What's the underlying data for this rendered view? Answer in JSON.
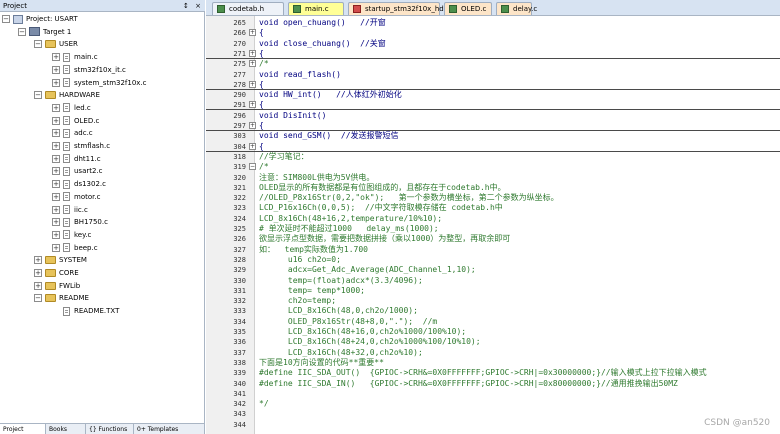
{
  "project": {
    "title": "Project",
    "header_buttons": "↕ ×",
    "tree": [
      {
        "label": "Project: USART",
        "level": 0,
        "icon": "project-root-icon",
        "expander": "−"
      },
      {
        "label": "Target 1",
        "level": 1,
        "icon": "target-icon",
        "expander": "−"
      },
      {
        "label": "USER",
        "level": 2,
        "icon": "folder-icon",
        "expander": "−"
      },
      {
        "label": "main.c",
        "level": 3,
        "icon": "c-file-icon",
        "expander": "+"
      },
      {
        "label": "stm32f10x_it.c",
        "level": 3,
        "icon": "c-file-icon",
        "expander": "+"
      },
      {
        "label": "system_stm32f10x.c",
        "level": 3,
        "icon": "c-file-icon",
        "expander": "+"
      },
      {
        "label": "HARDWARE",
        "level": 2,
        "icon": "folder-icon",
        "expander": "−"
      },
      {
        "label": "led.c",
        "level": 3,
        "icon": "c-file-icon",
        "expander": "+"
      },
      {
        "label": "OLED.c",
        "level": 3,
        "icon": "c-file-icon",
        "expander": "+"
      },
      {
        "label": "adc.c",
        "level": 3,
        "icon": "c-file-icon",
        "expander": "+"
      },
      {
        "label": "stmflash.c",
        "level": 3,
        "icon": "c-file-icon",
        "expander": "+"
      },
      {
        "label": "dht11.c",
        "level": 3,
        "icon": "c-file-icon",
        "expander": "+"
      },
      {
        "label": "usart2.c",
        "level": 3,
        "icon": "c-file-icon",
        "expander": "+"
      },
      {
        "label": "ds1302.c",
        "level": 3,
        "icon": "c-file-icon",
        "expander": "+"
      },
      {
        "label": "motor.c",
        "level": 3,
        "icon": "c-file-icon",
        "expander": "+"
      },
      {
        "label": "iic.c",
        "level": 3,
        "icon": "c-file-icon",
        "expander": "+"
      },
      {
        "label": "BH1750.c",
        "level": 3,
        "icon": "c-file-icon",
        "expander": "+"
      },
      {
        "label": "key.c",
        "level": 3,
        "icon": "c-file-icon",
        "expander": "+"
      },
      {
        "label": "beep.c",
        "level": 3,
        "icon": "c-file-icon",
        "expander": "+"
      },
      {
        "label": "SYSTEM",
        "level": 2,
        "icon": "folder-icon",
        "expander": "+"
      },
      {
        "label": "CORE",
        "level": 2,
        "icon": "folder-icon",
        "expander": "+"
      },
      {
        "label": "FWLib",
        "level": 2,
        "icon": "folder-icon",
        "expander": "+"
      },
      {
        "label": "README",
        "level": 2,
        "icon": "folder-icon",
        "expander": "−"
      },
      {
        "label": "README.TXT",
        "level": 3,
        "icon": "txt-file-icon",
        "expander": ""
      }
    ],
    "bottom_tabs": [
      {
        "label": "Project",
        "active": true
      },
      {
        "label": "Books",
        "active": false
      },
      {
        "label": "{} Functions",
        "active": false
      },
      {
        "label": "0+ Templates",
        "active": false
      }
    ]
  },
  "editor": {
    "tabs": [
      {
        "label": "codetab.h",
        "active": false,
        "style": "normal"
      },
      {
        "label": "main.c",
        "active": true,
        "style": "normal"
      },
      {
        "label": "startup_stm32f10x_hd.s",
        "active": false,
        "style": "orange"
      },
      {
        "label": "OLED.c",
        "active": false,
        "style": "orange"
      },
      {
        "label": "delay.c",
        "active": false,
        "style": "orange"
      }
    ],
    "lines": [
      {
        "n": "265",
        "fold": "",
        "text": "void open_chuang()   //开窗",
        "type": "normal",
        "sep": false
      },
      {
        "n": "266",
        "fold": "+",
        "text": "{",
        "type": "normal",
        "sep": false
      },
      {
        "n": "270",
        "fold": "",
        "text": "void close_chuang()  //关窗",
        "type": "normal",
        "sep": false
      },
      {
        "n": "271",
        "fold": "+",
        "text": "{",
        "type": "normal",
        "sep": true
      },
      {
        "n": "275",
        "fold": "+",
        "text": "/*",
        "type": "comment",
        "sep": false
      },
      {
        "n": "277",
        "fold": "",
        "text": "void read_flash()",
        "type": "normal",
        "sep": false
      },
      {
        "n": "278",
        "fold": "+",
        "text": "{",
        "type": "normal",
        "sep": true
      },
      {
        "n": "290",
        "fold": "",
        "text": "void HW_int()   //人体红外初始化",
        "type": "normal",
        "sep": false
      },
      {
        "n": "291",
        "fold": "+",
        "text": "{",
        "type": "normal",
        "sep": true
      },
      {
        "n": "296",
        "fold": "",
        "text": "void DisInit()",
        "type": "normal",
        "sep": false
      },
      {
        "n": "297",
        "fold": "+",
        "text": "{",
        "type": "normal",
        "sep": true
      },
      {
        "n": "303",
        "fold": "",
        "text": "void send_GSM()  //发送报警短信",
        "type": "normal",
        "sep": false
      },
      {
        "n": "304",
        "fold": "+",
        "text": "{",
        "type": "normal",
        "sep": true
      },
      {
        "n": "318",
        "fold": "",
        "text": "//学习笔记：",
        "type": "comment",
        "sep": false
      },
      {
        "n": "319",
        "fold": "−",
        "text": "/*",
        "type": "comment",
        "sep": false
      },
      {
        "n": "320",
        "fold": "",
        "text": "注意：SIM800L供电为5V供电。",
        "type": "comment",
        "sep": false
      },
      {
        "n": "321",
        "fold": "",
        "text": "OLED显示的所有数据都是有位图组成的，且都存在于codetab.h中。",
        "type": "comment",
        "sep": false
      },
      {
        "n": "322",
        "fold": "",
        "text": "//OLED_P8x16Str(0,2,\"ok\");   第一个参数为横坐标，第二个参数为纵坐标。",
        "type": "comment",
        "sep": false
      },
      {
        "n": "323",
        "fold": "",
        "text": "LCD_P16x16Ch(0,0,5);  //中文字符取模存储在 codetab.h中",
        "type": "comment",
        "sep": false
      },
      {
        "n": "324",
        "fold": "",
        "text": "LCD_8x16Ch(48+16,2,temperature/10%10);",
        "type": "comment",
        "sep": false
      },
      {
        "n": "325",
        "fold": "",
        "text": "# 单次延时不能超过1000   delay_ms(1000);",
        "type": "comment",
        "sep": false
      },
      {
        "n": "326",
        "fold": "",
        "text": "欲显示浮点型数据，需要把数据拼接（乘以1000）为整型，再取余即可",
        "type": "comment",
        "sep": false
      },
      {
        "n": "327",
        "fold": "",
        "text": "如：  temp实际数值为1.700",
        "type": "comment",
        "sep": false
      },
      {
        "n": "328",
        "fold": "",
        "text": "      u16 ch2o=0;",
        "type": "comment",
        "sep": false
      },
      {
        "n": "329",
        "fold": "",
        "text": "      adcx=Get_Adc_Average(ADC_Channel_1,10);",
        "type": "comment",
        "sep": false
      },
      {
        "n": "330",
        "fold": "",
        "text": "      temp=(float)adcx*(3.3/4096);",
        "type": "comment",
        "sep": false
      },
      {
        "n": "331",
        "fold": "",
        "text": "      temp= temp*1000;",
        "type": "comment",
        "sep": false
      },
      {
        "n": "332",
        "fold": "",
        "text": "      ch2o=temp;",
        "type": "comment",
        "sep": false
      },
      {
        "n": "333",
        "fold": "",
        "text": "      LCD_8x16Ch(48,0,ch2o/1000);",
        "type": "comment",
        "sep": false
      },
      {
        "n": "334",
        "fold": "",
        "text": "      OLED_P8x16Str(48+8,0,\".\");  //m",
        "type": "comment",
        "sep": false
      },
      {
        "n": "335",
        "fold": "",
        "text": "      LCD_8x16Ch(48+16,0,ch2o%1000/100%10);",
        "type": "comment",
        "sep": false
      },
      {
        "n": "336",
        "fold": "",
        "text": "      LCD_8x16Ch(48+24,0,ch2o%1000%100/10%10);",
        "type": "comment",
        "sep": false
      },
      {
        "n": "337",
        "fold": "",
        "text": "      LCD_8x16Ch(48+32,0,ch2o%10);",
        "type": "comment",
        "sep": false
      },
      {
        "n": "338",
        "fold": "",
        "text": "下面是10方向设置的代码**重要**",
        "type": "comment",
        "sep": false
      },
      {
        "n": "339",
        "fold": "",
        "text": "#define IIC_SDA_OUT()  {GPIOC->CRH&=0X0FFFFFFF;GPIOC->CRH|=0x30000000;}//输入模式上拉下拉输入模式",
        "type": "comment",
        "sep": false
      },
      {
        "n": "340",
        "fold": "",
        "text": "#define IIC_SDA_IN()   {GPIOC->CRH&=0X0FFFFFFF;GPIOC->CRH|=0x80000000;}//通用推挽输出50MZ",
        "type": "comment",
        "sep": false
      },
      {
        "n": "341",
        "fold": "",
        "text": "",
        "type": "comment",
        "sep": false
      },
      {
        "n": "342",
        "fold": "",
        "text": "*/",
        "type": "comment",
        "sep": false
      },
      {
        "n": "343",
        "fold": "",
        "text": "",
        "type": "normal",
        "sep": false
      },
      {
        "n": "344",
        "fold": "",
        "text": "",
        "type": "normal",
        "sep": false
      }
    ]
  },
  "watermark": "CSDN @an520"
}
